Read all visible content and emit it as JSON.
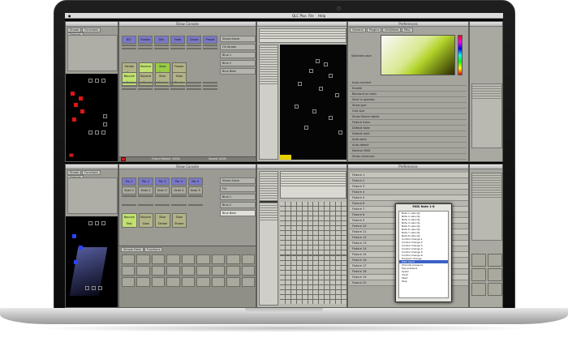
{
  "menubar": {
    "app": "QLC Plus",
    "file": "File",
    "help": "Help"
  },
  "top": {
    "main_title": "Show Console",
    "pref_title": "Preferences",
    "tabs": [
      "Shows",
      "Functions",
      "Fixtures"
    ],
    "pref_tabs": [
      "General",
      "Plugins",
      "Grid/View",
      "Misc"
    ],
    "buttons_row1": [
      "BLT",
      "Strobe",
      "Dim",
      "Fade",
      "Chase",
      "Preset"
    ],
    "buttons_row2": [
      "Strobe Fan",
      "Bounce",
      "Slow Scan",
      "Flower"
    ],
    "buttons_row3": [
      "Bounce Fast",
      "Bounce Slow",
      "Blue Strobe",
      "Slow Strobe"
    ],
    "side_items": [
      "Stand Alone",
      "Fill Strobe",
      "Blue 1",
      "Blue 2",
      "Blue Beat"
    ],
    "status_left": "Grand Master 100%",
    "status_right": "Speed 100%",
    "pref_rows": [
      "Auto-connect",
      "Enable",
      "Blackout on start",
      "Start in operate",
      "Show grid",
      "Grid size",
      "Show fixture labels",
      "Fixture icons",
      "Default fade",
      "Default hold",
      "Auto-save",
      "Auto-detect",
      "Monitor DMX",
      "Show universes"
    ],
    "pref_label": "Selected color"
  },
  "bottom": {
    "main_title": "Show Console",
    "pref_title": "Preferences",
    "tabs": [
      "Shows",
      "Functions",
      "Fixtures"
    ],
    "buttons_row1": [
      "Par 1",
      "Par 2",
      "Par 3",
      "Par 4",
      "Par 5"
    ],
    "buttons_row2": [
      "Scan 1",
      "Scan 2",
      "Scan 3",
      "Scan 4",
      "Scan 5"
    ],
    "buttons_row3": [
      "Bounce Fast",
      "Bounce Slow",
      "Blue Strobe",
      "Slow Strobe"
    ],
    "side_items": [
      "Stand Alone",
      "Fill",
      "Blue 1",
      "Blue 2",
      "Blue Beat"
    ],
    "dialog_title": "MIDI Note 1-8",
    "dialog_rows": [
      "Note 1 velocity",
      "Note 2 velocity",
      "Note 3 velocity",
      "Note 4 velocity",
      "Note 5 velocity",
      "Note 6 velocity",
      "Note 7 velocity",
      "Note 8 velocity",
      "Control change 1",
      "Control change 2",
      "Control change 3",
      "Control change 4",
      "Control change 5",
      "Control change 6",
      "Program change",
      "Pitch bend",
      "Channel pressure",
      "Key pressure",
      "Sysex",
      "Clock",
      "Start",
      "Stop"
    ],
    "dialog_selected": 15,
    "list_rows": [
      "Fixture 1",
      "Fixture 2",
      "Fixture 3",
      "Fixture 4",
      "Fixture 5",
      "Fixture 6",
      "Fixture 7",
      "Fixture 8",
      "Fixture 9",
      "Fixture 10",
      "Fixture 11",
      "Fixture 12",
      "Fixture 13",
      "Fixture 14",
      "Fixture 15",
      "Fixture 16",
      "Fixture 17",
      "Fixture 18",
      "Fixture 19",
      "Fixture 20"
    ],
    "bottom_tabs": [
      "Simple Desk",
      "Functions"
    ]
  },
  "colors": {
    "accent_purple": "#7a78c8",
    "accent_green": "#9acc48",
    "panel": "#9b9b93",
    "dmx_red": "#e01515",
    "dmx_blue": "#2a44ff"
  }
}
